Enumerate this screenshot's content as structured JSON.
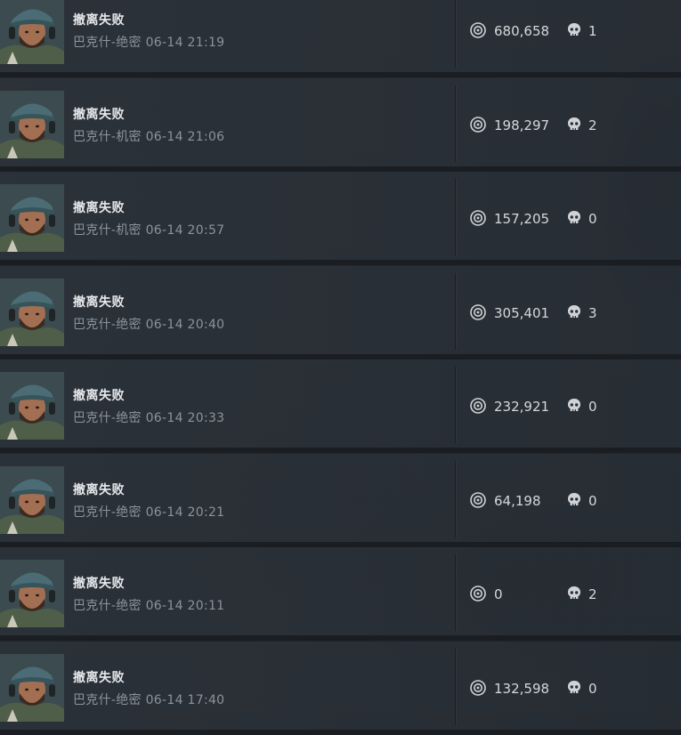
{
  "records": [
    {
      "result": "撤离失败",
      "detail": "巴克什-绝密 06-14 21:19",
      "value": "680,658",
      "kills": "1"
    },
    {
      "result": "撤离失败",
      "detail": "巴克什-机密 06-14 21:06",
      "value": "198,297",
      "kills": "2"
    },
    {
      "result": "撤离失败",
      "detail": "巴克什-机密 06-14 20:57",
      "value": "157,205",
      "kills": "0"
    },
    {
      "result": "撤离失败",
      "detail": "巴克什-绝密 06-14 20:40",
      "value": "305,401",
      "kills": "3"
    },
    {
      "result": "撤离失败",
      "detail": "巴克什-绝密 06-14 20:33",
      "value": "232,921",
      "kills": "0"
    },
    {
      "result": "撤离失败",
      "detail": "巴克什-绝密 06-14 20:21",
      "value": "64,198",
      "kills": "0"
    },
    {
      "result": "撤离失败",
      "detail": "巴克什-绝密 06-14 20:11",
      "value": "0",
      "kills": "2"
    },
    {
      "result": "撤离失败",
      "detail": "巴克什-绝密 06-14 17:40",
      "value": "132,598",
      "kills": "0"
    }
  ],
  "icons": {
    "value": "coin-icon",
    "kills": "skull-icon"
  },
  "colors": {
    "row_bg": "#2c3239",
    "title": "#e6e9ec",
    "subtitle": "#8b939b",
    "value_text": "#d4d8dc"
  }
}
